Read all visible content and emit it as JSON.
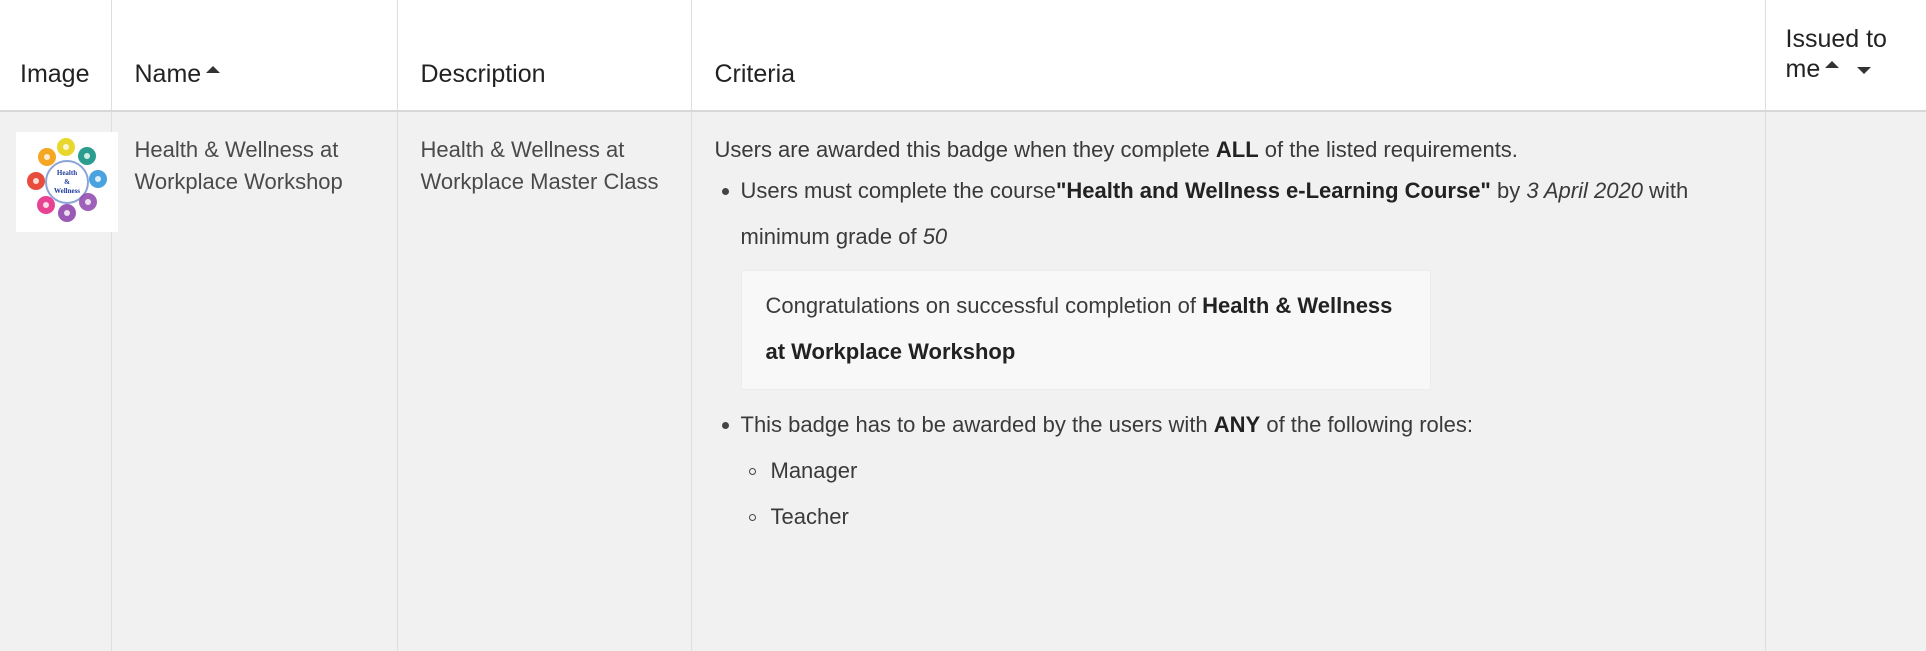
{
  "table": {
    "headers": {
      "image": "Image",
      "name": "Name",
      "description": "Description",
      "criteria": "Criteria",
      "issued_line1": "Issued to",
      "issued_line2": "me"
    },
    "row": {
      "name": "Health & Wellness at Workplace Workshop",
      "description": "Health & Wellness at Workplace Master Class",
      "criteria": {
        "intro_pre": "Users are awarded this badge when they complete ",
        "intro_bold": "ALL",
        "intro_post": " of the listed requirements.",
        "course_pre": "Users must complete the course",
        "course_name": "\"Health and Wellness e-Learning Course\"",
        "course_by": " by ",
        "course_date": "3 April 2020",
        "course_grade_pre": " with minimum grade of ",
        "course_grade": "50",
        "congrats_pre": "Congratulations on successful completion of ",
        "congrats_bold": "Health & Wellness at Workplace Workshop",
        "roles_pre": "This badge has to be awarded by the users with ",
        "roles_bold": "ANY",
        "roles_post": " of the following roles:",
        "roles": [
          "Manager",
          "Teacher"
        ]
      }
    }
  },
  "badge_image": {
    "center_text": [
      "Health",
      "&",
      "Wellness"
    ],
    "colors": [
      "#f5a623",
      "#e9d72e",
      "#2a9d8f",
      "#4aa3df",
      "#8e44ad",
      "#e84393",
      "#e74c3c",
      "#f39c12"
    ]
  },
  "colors": {
    "row_background": "#f1f1f1",
    "header_text": "#222222",
    "border": "#dedede"
  }
}
